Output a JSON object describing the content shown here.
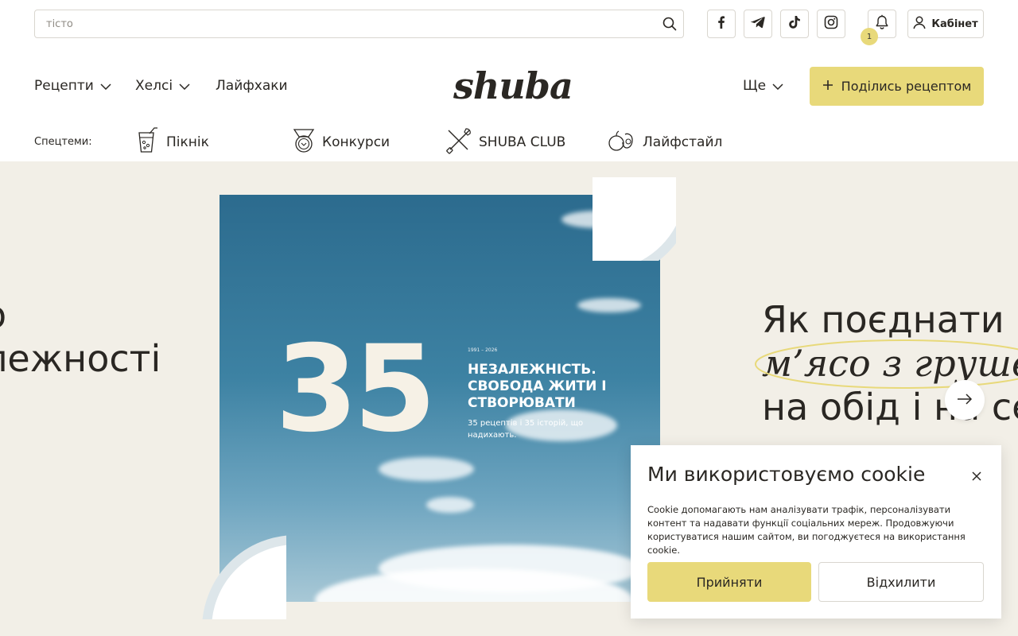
{
  "search": {
    "placeholder": "тісто",
    "icon": "search-icon"
  },
  "social": [
    {
      "name": "facebook-icon"
    },
    {
      "name": "telegram-icon"
    },
    {
      "name": "tiktok-icon"
    },
    {
      "name": "instagram-icon"
    }
  ],
  "notifications": {
    "count": "1"
  },
  "account": {
    "label": "Кабінет"
  },
  "nav": {
    "recipes": "Рецепти",
    "healthy": "Хелсі",
    "lifehacks": "Лайфхаки",
    "more": "Ще"
  },
  "logo": "shuba",
  "share_button": {
    "label": "Поділись рецептом"
  },
  "special_topics": {
    "label": "Спецтеми:",
    "items": [
      "Пікнік",
      "Конкурси",
      "SHUBA CLUB",
      "Лайфстайл"
    ]
  },
  "hero": {
    "left_text_line1": "о",
    "left_text_line2": "лежності",
    "slide": {
      "number": "35",
      "years": "1991 – 2026",
      "title": "Незалежність. Свобода жити і створювати",
      "subtitle": "35 рецептів і 35 історій, що надихають."
    },
    "right_text_line1": "Як поєднати",
    "right_text_line2": "м’ясо з грушею",
    "right_text_line3": "на обід і на се"
  },
  "cookie": {
    "title": "Ми використовуємо cookie",
    "text": "Cookie допомагають нам аналізувати трафік, персоналізувати контент та надавати функції соціальних мереж. Продовжуючи користуватися нашим сайтом, ви погоджуєтеся на використання cookie.",
    "accept": "Прийняти",
    "decline": "Відхилити"
  },
  "colors": {
    "accent": "#e8d97a",
    "hero_bg": "#f2efe7",
    "text": "#2a2723"
  }
}
